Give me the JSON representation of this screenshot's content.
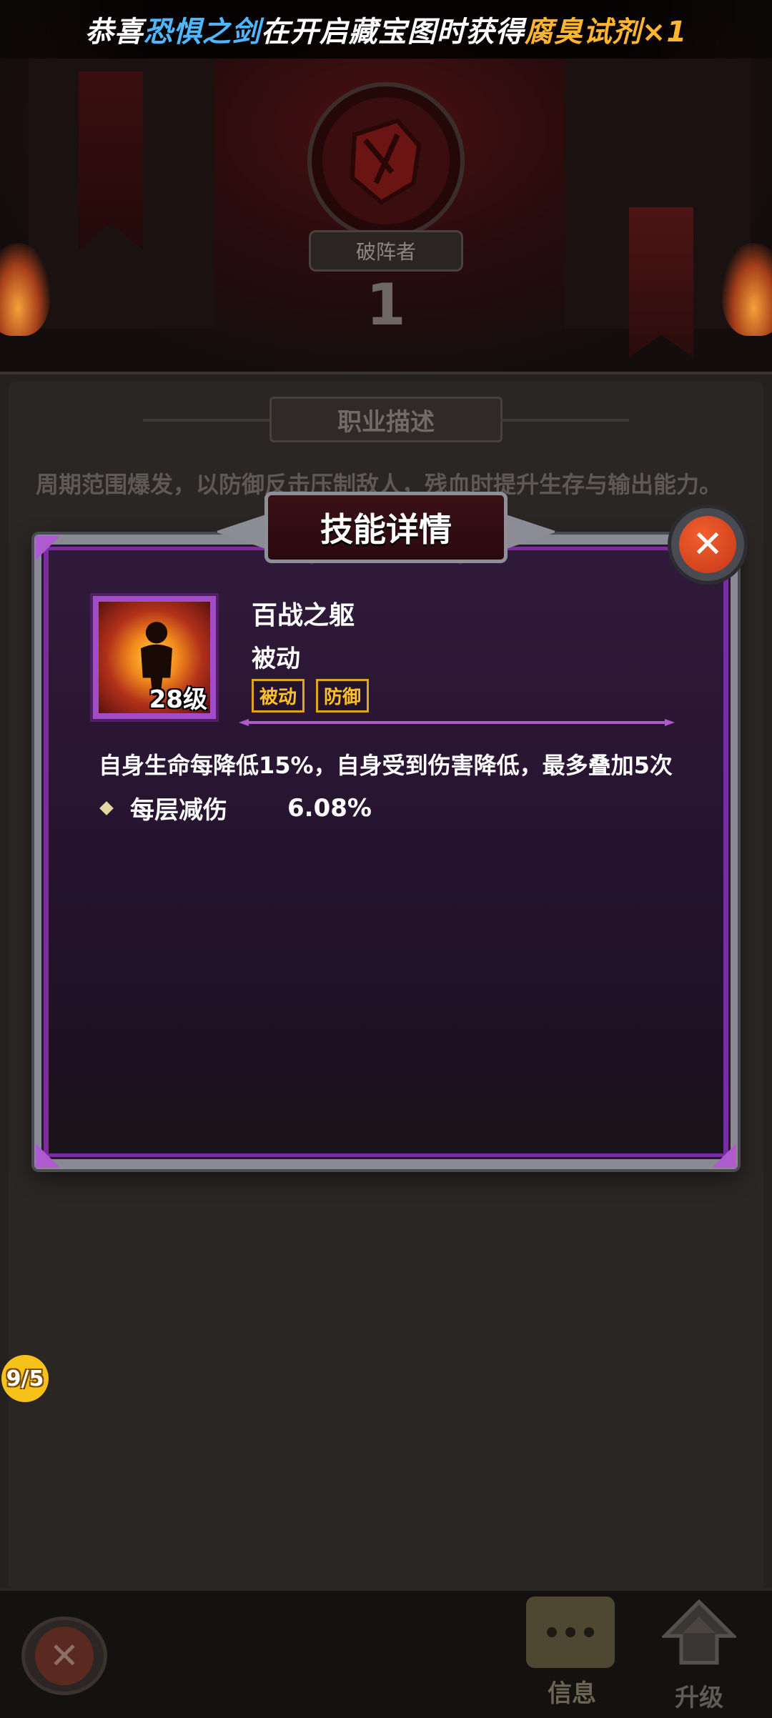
{
  "notification": {
    "prefix": "恭喜",
    "player": "恐惧之剑",
    "middle": "在开启藏宝图时获得",
    "item": "腐臭试剂×1"
  },
  "hero": {
    "class_name": "破阵者",
    "level": "1"
  },
  "class_section": {
    "title": "职业描述",
    "description": "周期范围爆发，以防御反击压制敌人，残血时提升生存与输出能力。"
  },
  "skill_dialog": {
    "title": "技能详情",
    "close_label": "✕",
    "skill_name": "百战之躯",
    "skill_type": "被动",
    "skill_level": "28级",
    "tags": [
      "被动",
      "防御"
    ],
    "effect": "自身生命每降低15%，自身受到伤害降低，最多叠加5次",
    "stat_label": "每层减伤",
    "stat_value": "6.08%"
  },
  "side_badge": "9/5",
  "bottom_bar": {
    "back_label": "✕",
    "info_label": "信息",
    "upgrade_label": "升级"
  },
  "colors": {
    "notice_player": "#4fb7ff",
    "notice_item": "#ffb52e",
    "dialog_frame": "#7a2da0",
    "tag_border": "#e0a51e",
    "close_button": "#e24e26"
  },
  "icons": {
    "close": "close-x-icon",
    "skill": "flaming-figure-icon",
    "stat_bullet": "diamond-bullet-icon",
    "info": "chat-bubble-icon",
    "upgrade": "up-arrow-icon",
    "emblem": "broken-shield-emblem-icon"
  }
}
